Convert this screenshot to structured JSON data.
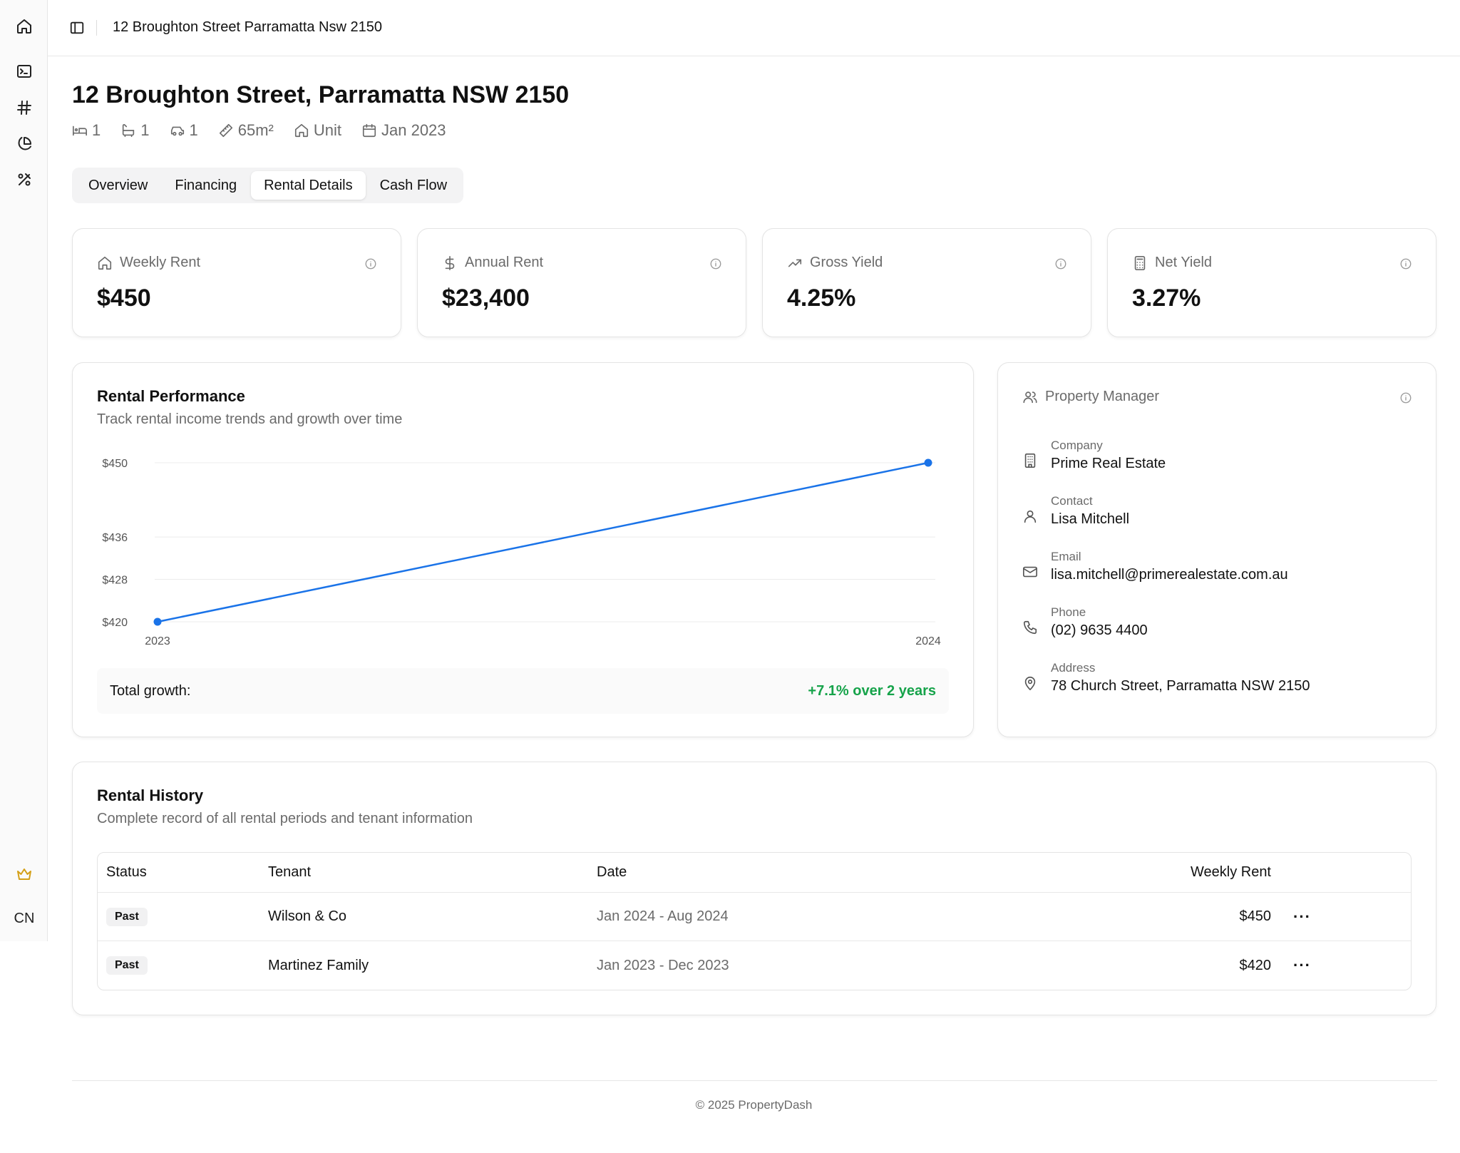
{
  "sidebar": {
    "items": [
      {
        "icon": "home-icon"
      },
      {
        "icon": "terminal-icon"
      },
      {
        "icon": "hash-icon"
      },
      {
        "icon": "pie-chart-icon"
      },
      {
        "icon": "percent-tools-icon"
      }
    ],
    "premium_icon": "crown-icon",
    "avatar_initials": "CN"
  },
  "header": {
    "breadcrumb": "12 Broughton Street Parramatta Nsw 2150"
  },
  "property": {
    "title": "12 Broughton Street, Parramatta NSW 2150",
    "meta": {
      "beds": "1",
      "baths": "1",
      "cars": "1",
      "area": "65m²",
      "type": "Unit",
      "date": "Jan 2023"
    }
  },
  "tabs": [
    {
      "label": "Overview"
    },
    {
      "label": "Financing"
    },
    {
      "label": "Rental Details",
      "active": true
    },
    {
      "label": "Cash Flow"
    }
  ],
  "stats": [
    {
      "label": "Weekly Rent",
      "value": "$450",
      "icon": "home-icon"
    },
    {
      "label": "Annual Rent",
      "value": "$23,400",
      "icon": "dollar-icon"
    },
    {
      "label": "Gross Yield",
      "value": "4.25%",
      "icon": "trending-up-icon"
    },
    {
      "label": "Net Yield",
      "value": "3.27%",
      "icon": "calculator-icon"
    }
  ],
  "performance": {
    "title": "Rental Performance",
    "subtitle": "Track rental income trends and growth over time",
    "growth_label": "Total growth:",
    "growth_value": "+7.1% over 2 years"
  },
  "chart_data": {
    "type": "line",
    "title": "",
    "xlabel": "",
    "ylabel": "",
    "categories": [
      "2023",
      "2024"
    ],
    "series": [
      {
        "values": [
          420,
          450
        ]
      }
    ],
    "y_ticks": [
      "$450",
      "$436",
      "$428",
      "$420"
    ],
    "ylim": [
      420,
      450
    ],
    "grid": true,
    "color": "#1a73e8"
  },
  "manager": {
    "title": "Property Manager",
    "fields": [
      {
        "label": "Company",
        "value": "Prime Real Estate",
        "icon": "building-icon"
      },
      {
        "label": "Contact",
        "value": "Lisa Mitchell",
        "icon": "user-icon"
      },
      {
        "label": "Email",
        "value": "lisa.mitchell@primerealestate.com.au",
        "icon": "mail-icon"
      },
      {
        "label": "Phone",
        "value": "(02) 9635 4400",
        "icon": "phone-icon"
      },
      {
        "label": "Address",
        "value": "78 Church Street, Parramatta NSW 2150",
        "icon": "map-pin-icon"
      }
    ]
  },
  "history": {
    "title": "Rental History",
    "subtitle": "Complete record of all rental periods and tenant information",
    "columns": {
      "status": "Status",
      "tenant": "Tenant",
      "date": "Date",
      "rent": "Weekly Rent"
    },
    "rows": [
      {
        "status": "Past",
        "tenant": "Wilson & Co",
        "date": "Jan 2024 - Aug 2024",
        "rent": "$450",
        "more": "···"
      },
      {
        "status": "Past",
        "tenant": "Martinez Family",
        "date": "Jan 2023 - Dec 2023",
        "rent": "$420",
        "more": "···"
      }
    ]
  },
  "footer": {
    "text": "© 2025 PropertyDash"
  }
}
